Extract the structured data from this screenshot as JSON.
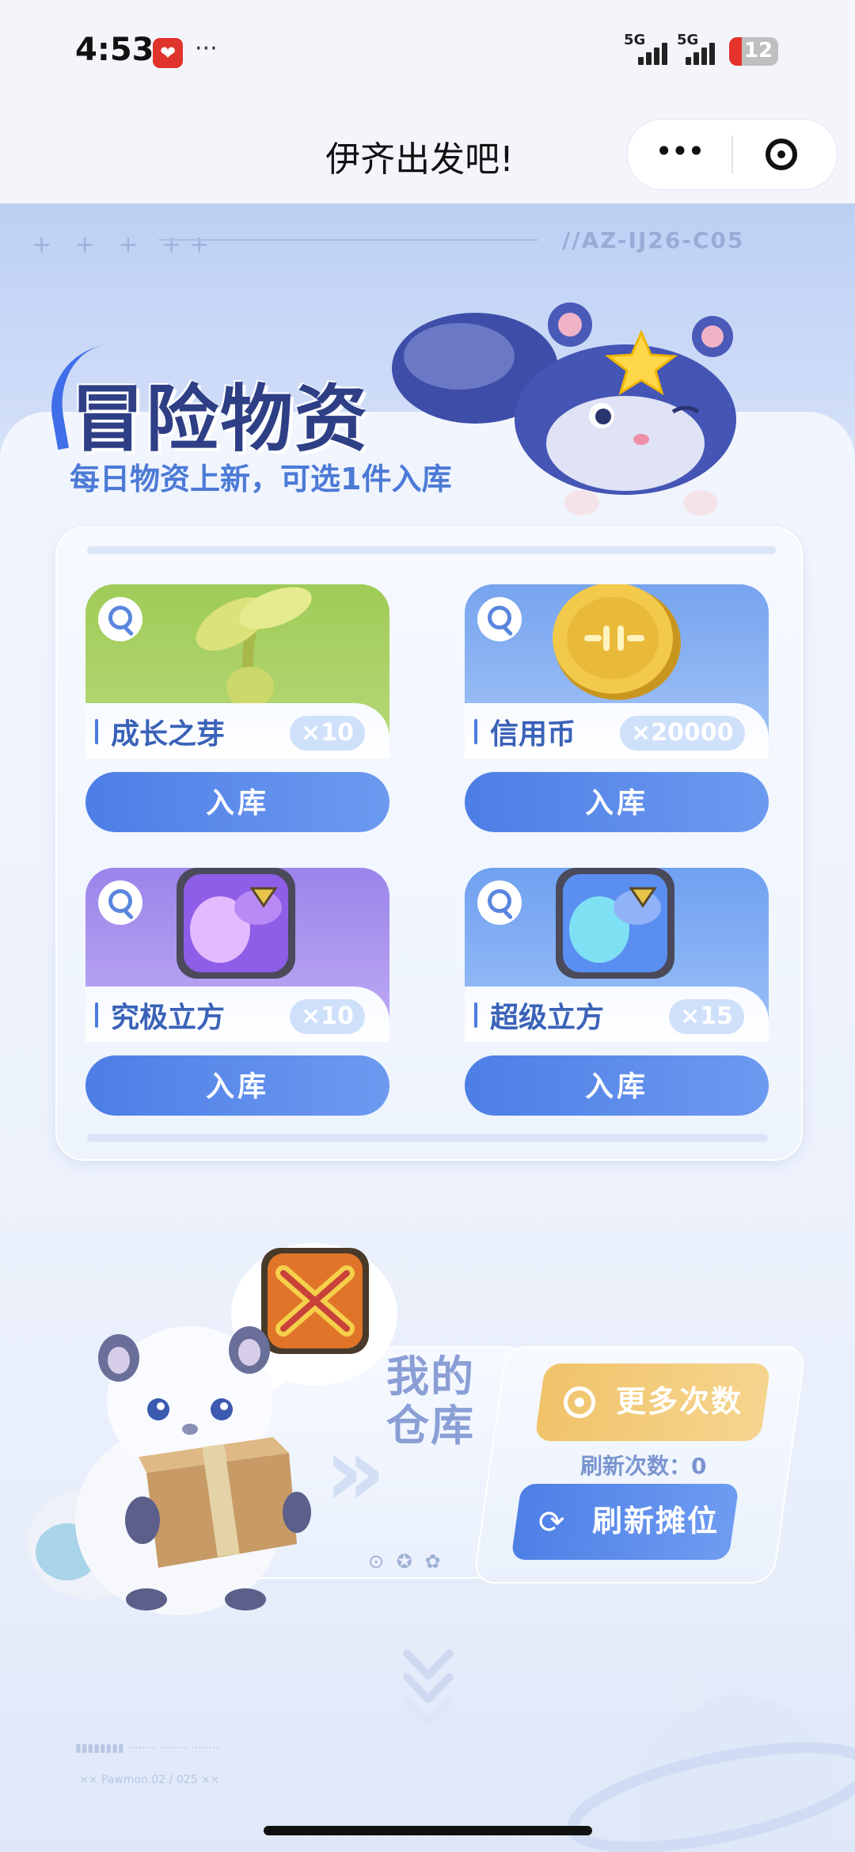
{
  "status_bar": {
    "time": "4:53",
    "app_icon_glyph": "❤",
    "more": "···",
    "signal1": "5G",
    "signal2": "5G",
    "battery": "12"
  },
  "nav": {
    "title": "伊齐出发吧!",
    "more_glyph": "•••"
  },
  "hero": {
    "deco_marks": "+ + + ++",
    "code_text": "//AZ-IJ26-C05",
    "title": "冒险物资",
    "subtitle": "每日物资上新，可选1件入库"
  },
  "items": [
    {
      "name": "成长之芽",
      "qty": "×10",
      "button": "入库",
      "icon": "sprout-icon"
    },
    {
      "name": "信用币",
      "qty": "×20000",
      "button": "入库",
      "icon": "coin-icon"
    },
    {
      "name": "究极立方",
      "qty": "×10",
      "button": "入库",
      "icon": "ultimate-cube-icon"
    },
    {
      "name": "超级立方",
      "qty": "×15",
      "button": "入库",
      "icon": "super-cube-icon"
    }
  ],
  "warehouse": {
    "title": "我的仓库",
    "arrows": "»",
    "icons": "⊙ ✪ ✿"
  },
  "actions": {
    "more_times": "更多次数",
    "refresh_count": "刷新次数：0",
    "refresh_stall": "刷新摊位",
    "refresh_glyph": "⟳"
  },
  "footer": {
    "line1": "▮▮▮▮▮▮▮▮  ········  ········  ········",
    "line2": "×× Pawmon 02 / 025 ××"
  },
  "colors": {
    "accent_blue": "#4d7ee6",
    "accent_gold": "#f0c36a",
    "title_navy": "#2f3f86"
  }
}
